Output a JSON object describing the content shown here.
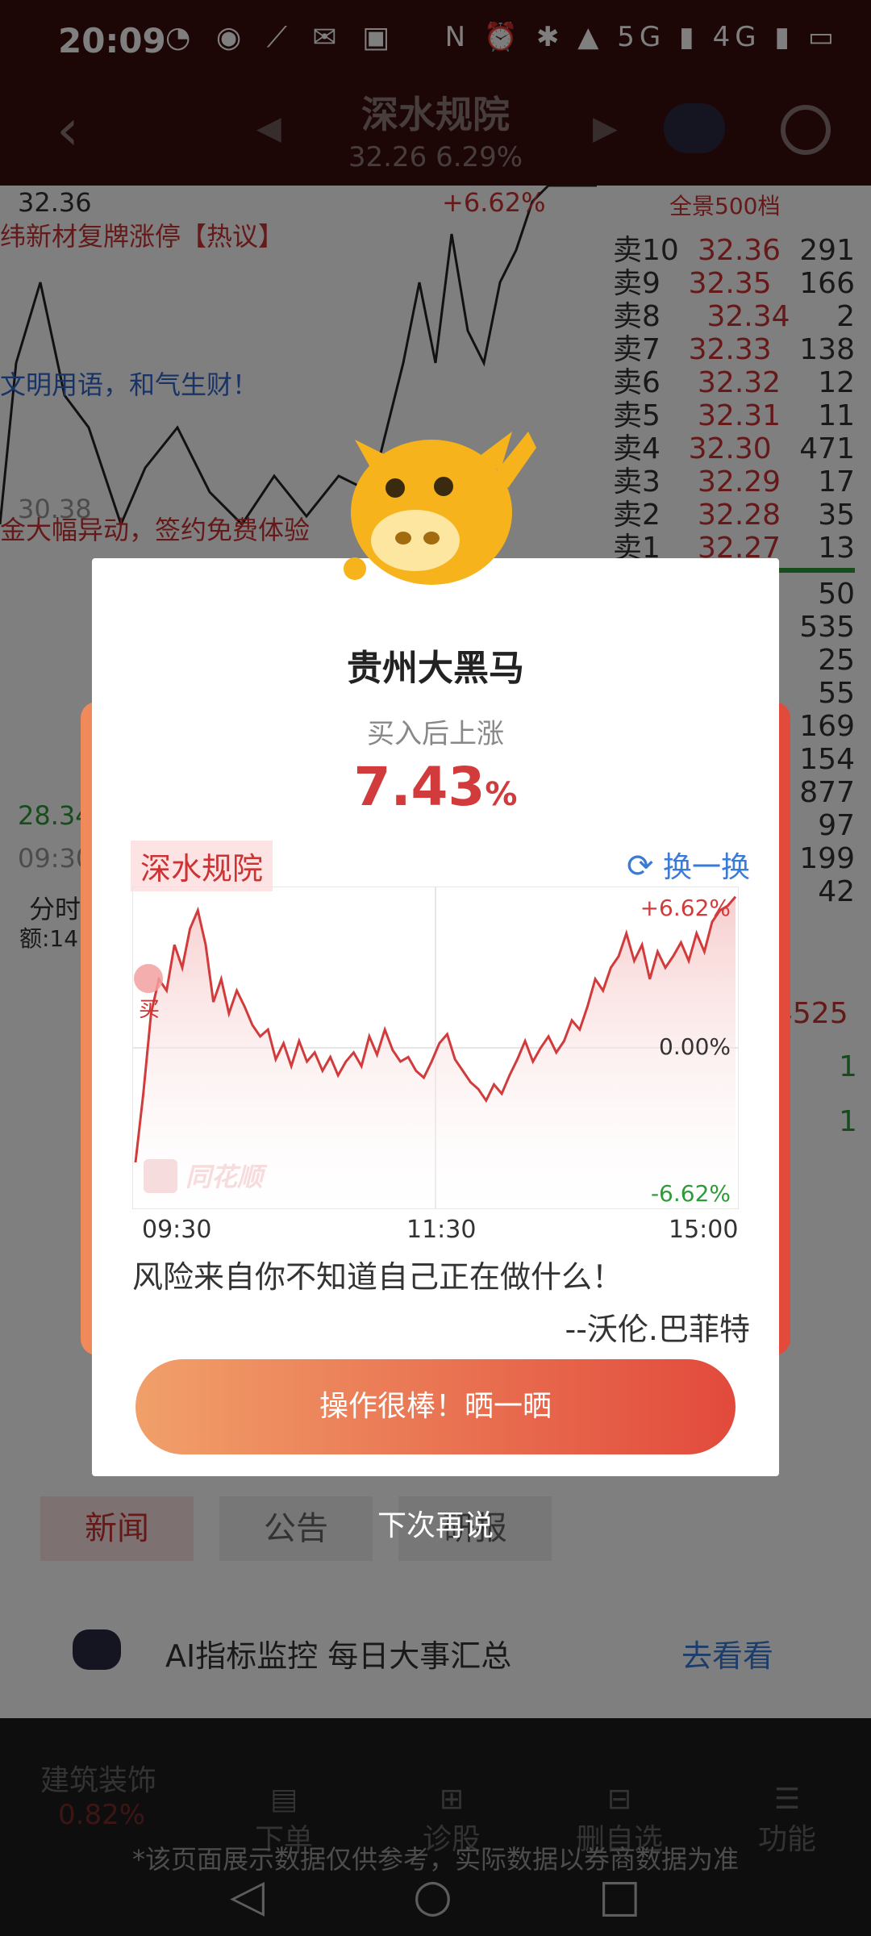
{
  "status_bar": {
    "time": "20:09",
    "left_icons": "◔ ◉ ⟋ ✉ ▣",
    "right_icons": "N ⏰ ✱ ▲ 5G ▮ 4G ▮ ▭"
  },
  "header": {
    "title": "深水规院",
    "price": "32.26",
    "change": "6.29%"
  },
  "background": {
    "ticker_lines": [
      "纬新材复牌涨停【热议】",
      "文明用语，和气生财！",
      "金大幅异动，签约免费体验"
    ],
    "price_labels": [
      "32.36",
      "+6.62%",
      "28.34",
      "09:30",
      "30.38"
    ],
    "orderbook_title": "全景500档",
    "orderbook": [
      {
        "label": "卖10",
        "price": "32.36",
        "vol": "291"
      },
      {
        "label": "卖9",
        "price": "32.35",
        "vol": "166"
      },
      {
        "label": "卖8",
        "price": "32.34",
        "vol": "2"
      },
      {
        "label": "卖7",
        "price": "32.33",
        "vol": "138"
      },
      {
        "label": "卖6",
        "price": "32.32",
        "vol": "12"
      },
      {
        "label": "卖5",
        "price": "32.31",
        "vol": "11"
      },
      {
        "label": "卖4",
        "price": "32.30",
        "vol": "471"
      },
      {
        "label": "卖3",
        "price": "32.29",
        "vol": "17"
      },
      {
        "label": "卖2",
        "price": "32.28",
        "vol": "35"
      },
      {
        "label": "卖1",
        "price": "32.27",
        "vol": "13"
      }
    ],
    "orderbook_bids": [
      "50",
      "535",
      "25",
      "55",
      "169",
      "154",
      "877",
      "97",
      "199",
      "42"
    ],
    "right_numbers": [
      "4525",
      "1",
      "1"
    ],
    "chart_side_labels": [
      "分时",
      "额:14"
    ],
    "tabs": [
      "新闻",
      "公告",
      "研报"
    ],
    "ai_banner": {
      "text": "AI指标监控 每日大事汇总",
      "link": "去看看"
    },
    "sector": {
      "name": "建筑装饰",
      "change": "0.82%"
    },
    "bottom_nav": [
      "下单",
      "诊股",
      "删自选",
      "功能"
    ],
    "disclaimer": "*该页面展示数据仅供参考，实际数据以券商数据为准"
  },
  "modal": {
    "title": "贵州大黑马",
    "subtitle": "买入后上涨",
    "gain_value": "7.43",
    "gain_unit": "%",
    "stock_name": "深水规院",
    "switch_label": "换一换",
    "quote": "风险来自你不知道自己正在做什么！",
    "author": "--沃伦.巴菲特",
    "share_button": "操作很棒！晒一晒",
    "dismiss": "下次再说",
    "watermark": "同花顺",
    "buy_marker": "买"
  },
  "chart_data": {
    "type": "line",
    "x_ticks": [
      "09:30",
      "11:30",
      "15:00"
    ],
    "y_labels": {
      "top": "+6.62%",
      "mid": "0.00%",
      "bottom": "-6.62%"
    },
    "ylim": [
      -6.62,
      6.62
    ],
    "series": [
      {
        "values": [
          -5.0,
          -2.0,
          1.5,
          3.0,
          2.5,
          4.5,
          3.5,
          5.2,
          6.0,
          4.5,
          2.0,
          3.0,
          1.5,
          2.5,
          1.8,
          1.0,
          0.5,
          0.8,
          -0.5,
          0.2,
          -0.8,
          0.3,
          -0.6,
          -0.2,
          -1.0,
          -0.4,
          -1.2,
          -0.6,
          -0.2,
          -0.8,
          0.5,
          -0.3,
          0.8,
          -0.1,
          -0.6,
          -0.4,
          -1.0,
          -1.3,
          -0.6,
          0.2,
          0.6,
          -0.5,
          -1.0,
          -1.5,
          -1.8,
          -2.3,
          -1.6,
          -2.0,
          -1.2,
          -0.5,
          0.3,
          -0.6,
          0.0,
          0.5,
          -0.2,
          0.3,
          1.2,
          0.8,
          1.8,
          3.0,
          2.5,
          3.5,
          4.0,
          5.0,
          3.8,
          4.5,
          3.0,
          4.2,
          3.5,
          4.0,
          4.6,
          3.8,
          5.0,
          4.2,
          5.5,
          6.0,
          6.2,
          6.6
        ]
      }
    ]
  },
  "colors": {
    "accent": "#d23b3b",
    "up": "#c33333",
    "down": "#2e9a3a",
    "link": "#3a7bd5"
  }
}
